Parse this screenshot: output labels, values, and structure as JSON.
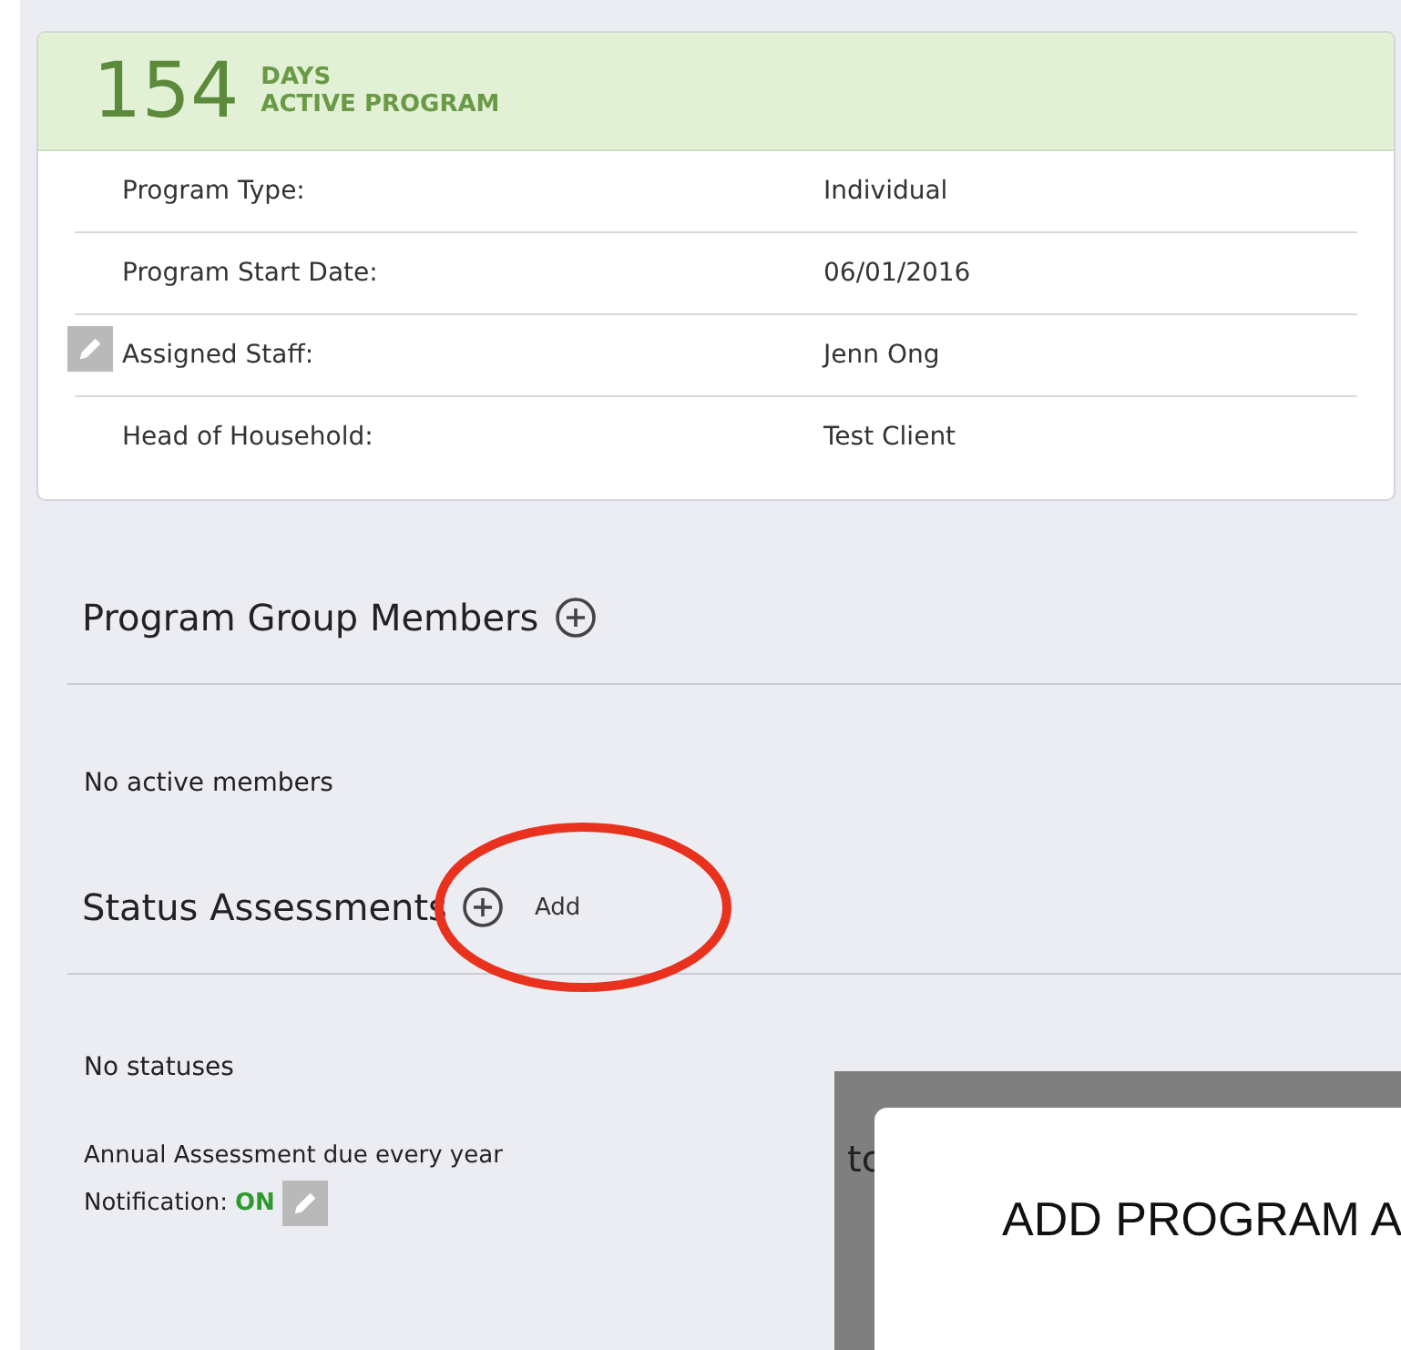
{
  "program_card": {
    "days_count": "154",
    "days_label": "DAYS",
    "status_label": "ACTIVE PROGRAM",
    "fields": [
      {
        "label": "Program Type:",
        "value": "Individual",
        "editable": false
      },
      {
        "label": "Program Start Date:",
        "value": "06/01/2016",
        "editable": false
      },
      {
        "label": "Assigned Staff:",
        "value": "Jenn Ong",
        "editable": true
      },
      {
        "label": "Head of Household:",
        "value": "Test Client",
        "editable": false
      }
    ]
  },
  "group_members": {
    "title": "Program Group Members",
    "empty_text": "No active members"
  },
  "status_assessments": {
    "title": "Status Assessments",
    "add_label": "Add",
    "empty_text": "No statuses",
    "due_text": "Annual Assessment due every year",
    "notification_label": "Notification:",
    "notification_state": "ON",
    "notification_on": true
  },
  "dialog": {
    "backdrop_text": "tc",
    "title": "ADD PROGRAM A"
  }
}
